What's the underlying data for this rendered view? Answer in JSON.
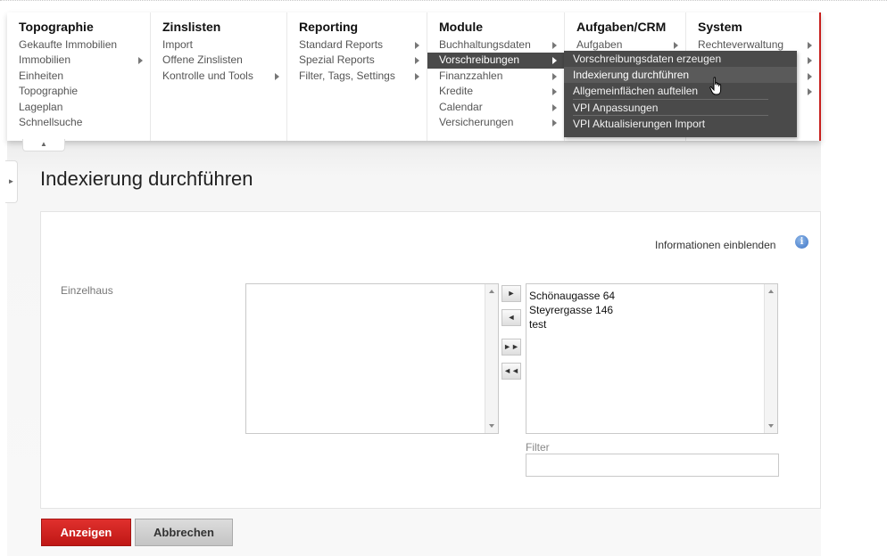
{
  "menu": {
    "columns": [
      {
        "title": "Topographie",
        "items": [
          {
            "label": "Gekaufte Immobilien",
            "arrow": false
          },
          {
            "label": "Immobilien",
            "arrow": true
          },
          {
            "label": "Einheiten",
            "arrow": false
          },
          {
            "label": "Topographie",
            "arrow": false
          },
          {
            "label": "Lageplan",
            "arrow": false
          },
          {
            "label": "Schnellsuche",
            "arrow": false
          }
        ]
      },
      {
        "title": "Zinslisten",
        "items": [
          {
            "label": "Import",
            "arrow": false
          },
          {
            "label": "Offene Zinslisten",
            "arrow": false
          },
          {
            "label": "Kontrolle und Tools",
            "arrow": true
          }
        ]
      },
      {
        "title": "Reporting",
        "items": [
          {
            "label": "Standard Reports",
            "arrow": true
          },
          {
            "label": "Spezial Reports",
            "arrow": true
          },
          {
            "label": "Filter, Tags, Settings",
            "arrow": true
          }
        ]
      },
      {
        "title": "Module",
        "items": [
          {
            "label": "Buchhaltungsdaten",
            "arrow": true
          },
          {
            "label": "Vorschreibungen",
            "arrow": true,
            "active": true
          },
          {
            "label": "Finanzzahlen",
            "arrow": true
          },
          {
            "label": "Kredite",
            "arrow": true
          },
          {
            "label": "Calendar",
            "arrow": true
          },
          {
            "label": "Versicherungen",
            "arrow": true
          }
        ]
      },
      {
        "title": "Aufgaben/CRM",
        "items": [
          {
            "label": "Aufgaben",
            "arrow": true
          }
        ]
      },
      {
        "title": "System",
        "items": [
          {
            "label": "Rechteverwaltung",
            "arrow": true
          },
          {
            "label": "",
            "arrow": true
          },
          {
            "label": "",
            "arrow": true
          },
          {
            "label": "",
            "arrow": true
          }
        ]
      }
    ],
    "submenu": [
      {
        "label": "Vorschreibungsdaten erzeugen",
        "hover": false
      },
      {
        "label": "Indexierung durchführen",
        "hover": true
      },
      {
        "label": "Allgemeinflächen aufteilen",
        "hover": false,
        "separator": true
      },
      {
        "label": "VPI Anpassungen",
        "hover": false,
        "separator": true
      },
      {
        "label": "VPI Aktualisierungen Import",
        "hover": false
      }
    ]
  },
  "page": {
    "title": "Indexierung durchführen",
    "info_link": "Informationen einblenden"
  },
  "form": {
    "field_label": "Einzelhaus",
    "available_options": [],
    "selected_options": [
      "Schönaugasse 64",
      "Steyrergasse 146",
      "test"
    ],
    "move_buttons": {
      "add": "►",
      "remove": "◄",
      "add_all": "►►",
      "remove_all": "◄◄"
    },
    "filter_label": "Filter",
    "filter_value": ""
  },
  "buttons": {
    "submit": "Anzeigen",
    "cancel": "Abbrechen"
  },
  "colors": {
    "accent_red": "#c8201e",
    "menu_active_bg": "#4a4a4a",
    "info_blue": "#3d73c6"
  }
}
